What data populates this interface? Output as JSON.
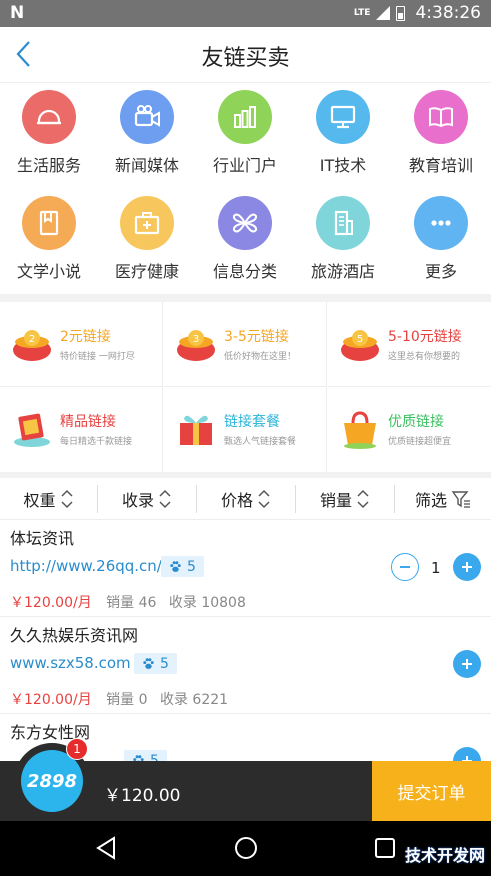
{
  "status_bar": {
    "carrier_icon": "N",
    "network": "LTE",
    "time": "4:38:26"
  },
  "header": {
    "title": "友链买卖",
    "back_icon": "chevron-left-icon"
  },
  "categories": [
    {
      "label": "生活服务",
      "icon": "helmet-icon",
      "color": "#ea6b67"
    },
    {
      "label": "新闻媒体",
      "icon": "camera-icon",
      "color": "#6d9ef0"
    },
    {
      "label": "行业门户",
      "icon": "bar-chart-icon",
      "color": "#8fd358"
    },
    {
      "label": "IT技术",
      "icon": "monitor-icon",
      "color": "#56b9ee"
    },
    {
      "label": "教育培训",
      "icon": "book-icon",
      "color": "#e86fcc"
    },
    {
      "label": "文学小说",
      "icon": "notebook-icon",
      "color": "#f5aa55"
    },
    {
      "label": "医疗健康",
      "icon": "medkit-icon",
      "color": "#f7c75d"
    },
    {
      "label": "信息分类",
      "icon": "flower-icon",
      "color": "#8b88e3"
    },
    {
      "label": "旅游酒店",
      "icon": "building-icon",
      "color": "#7fd5d9"
    },
    {
      "label": "更多",
      "icon": "more-icon",
      "color": "#5fb4f1"
    }
  ],
  "promos": [
    {
      "title": "2元链接",
      "subtitle": "特价链接 一网打尽",
      "color": "#f5a623",
      "badge": "2"
    },
    {
      "title": "3-5元链接",
      "subtitle": "低价好物在这里！",
      "color": "#f5a623",
      "badge": "3"
    },
    {
      "title": "5-10元链接",
      "subtitle": "这里总有你想要的",
      "color": "#e64340",
      "badge": "5"
    },
    {
      "title": "精品链接",
      "subtitle": "每日精选千款链接",
      "color": "#e64340"
    },
    {
      "title": "链接套餐",
      "subtitle": "甄选人气链接套餐",
      "color": "#2bb5d8"
    },
    {
      "title": "优质链接",
      "subtitle": "优质链接超便宜",
      "color": "#3bbf60"
    }
  ],
  "sort": [
    {
      "label": "权重"
    },
    {
      "label": "收录"
    },
    {
      "label": "价格"
    },
    {
      "label": "销量"
    },
    {
      "label": "筛选"
    }
  ],
  "items": [
    {
      "name": "体坛资讯",
      "url": "http://www.26qq.cn/",
      "badge": "5",
      "price": "￥120.00/月",
      "sales": "销量 46",
      "indexed": "收录 10808",
      "qty": "1"
    },
    {
      "name": "久久热娱乐资讯网",
      "url": "www.szx58.com",
      "badge": "5",
      "price": "￥120.00/月",
      "sales": "销量 0",
      "indexed": "收录 6221"
    },
    {
      "name": "东方女性网",
      "url": "",
      "badge": "5",
      "price": "",
      "sales": "",
      "indexed": ""
    }
  ],
  "cart": {
    "count": "1",
    "total": "￥120.00",
    "submit_label": "提交订单",
    "logo_text": "2898"
  },
  "watermark": "技术开发网"
}
